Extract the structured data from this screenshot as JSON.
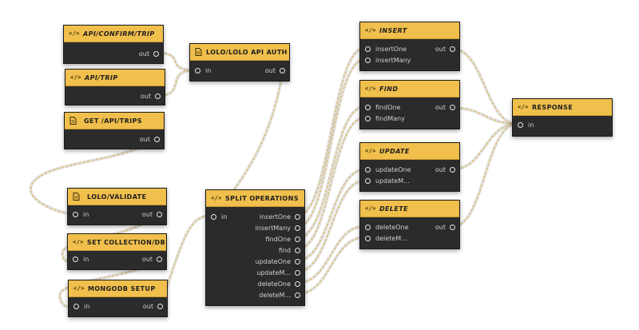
{
  "nodes": {
    "api_confirm_trip": {
      "title": "API/CONFIRM/TRIP",
      "out": "out"
    },
    "lolo_auth": {
      "title": "LOLO/LOLO API AUTH",
      "in": "in",
      "out": "out"
    },
    "api_trip": {
      "title": "API/TRIP",
      "out": "out"
    },
    "get_trips": {
      "title": "GET /API/TRIPS",
      "out": "out"
    },
    "lolo_validate": {
      "title": "LOLO/VALIDATE",
      "in": "in",
      "out": "out"
    },
    "set_collection": {
      "title": "SET COLLECTION/DB",
      "in": "in",
      "out": "out"
    },
    "mongodb_setup": {
      "title": "MONGODB SETUP",
      "in": "in",
      "out": "out"
    },
    "split_operations": {
      "title": "SPLIT OPERATIONS",
      "in": "in",
      "outputs": [
        "insertOne",
        "insertMany",
        "findOne",
        "find",
        "updateOne",
        "updateM...",
        "deleteOne",
        "deleteM..."
      ]
    },
    "insert": {
      "title": "INSERT",
      "inputs": [
        "insertOne",
        "insertMany"
      ],
      "out": "out"
    },
    "find": {
      "title": "FIND",
      "inputs": [
        "findOne",
        "findMany"
      ],
      "out": "out"
    },
    "update": {
      "title": "UPDATE",
      "inputs": [
        "updateOne",
        "updateM..."
      ],
      "out": "out"
    },
    "delete": {
      "title": "DELETE",
      "inputs": [
        "deleteOne",
        "deleteM..."
      ],
      "out": "out"
    },
    "response": {
      "title": "RESPONSE",
      "in": "in"
    }
  },
  "colors": {
    "header": "#f0bf4c",
    "body": "#2b2b2b",
    "wire": "#e2bb5c",
    "port": "#e6e6e6"
  }
}
